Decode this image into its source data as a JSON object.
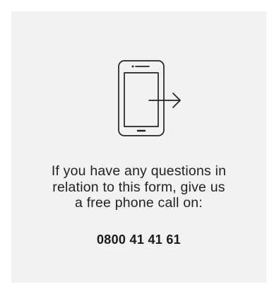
{
  "info_card": {
    "icon": "phone-call-icon",
    "message_lines": [
      "If you have any questions in",
      "relation to this form, give us",
      "a free phone call on:"
    ],
    "phone_number": "0800 41 41 61"
  }
}
